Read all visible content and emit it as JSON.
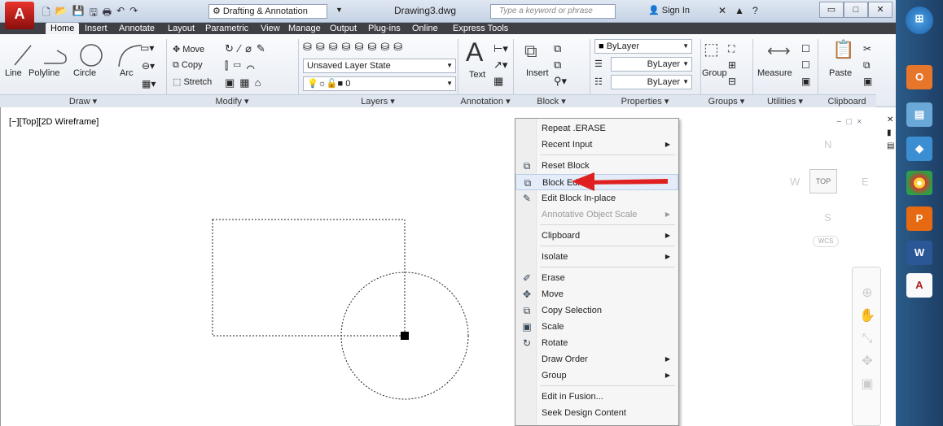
{
  "app": {
    "logo_letter": "A",
    "workspace": "Drafting & Annotation",
    "doc_title": "Drawing3.dwg",
    "search_placeholder": "Type a keyword or phrase",
    "signin": "Sign In"
  },
  "tabs": [
    "Home",
    "Insert",
    "Annotate",
    "Layout",
    "Parametric",
    "View",
    "Manage",
    "Output",
    "Plug-ins",
    "Online",
    "Express Tools"
  ],
  "ribbon": {
    "draw": {
      "title": "Draw",
      "items": [
        "Line",
        "Polyline",
        "Circle",
        "Arc"
      ]
    },
    "modify": {
      "title": "Modify",
      "move": "Move",
      "copy": "Copy",
      "stretch": "Stretch"
    },
    "layers": {
      "title": "Layers",
      "state": "Unsaved Layer State",
      "layer": "0"
    },
    "annotation": {
      "title": "Annotation",
      "text": "Text"
    },
    "block": {
      "title": "Block",
      "insert": "Insert"
    },
    "properties": {
      "title": "Properties",
      "color": "ByLayer",
      "linetype": "ByLayer",
      "lineweight": "ByLayer"
    },
    "groups": {
      "title": "Groups",
      "group": "Group"
    },
    "utilities": {
      "title": "Utilities",
      "measure": "Measure"
    },
    "clipboard": {
      "title": "Clipboard",
      "paste": "Paste"
    }
  },
  "viewport": {
    "label": "[−][Top][2D Wireframe]",
    "ctrl_min": "−",
    "ctrl_max": "□",
    "ctrl_close": "×"
  },
  "viewcube": {
    "n": "N",
    "s": "S",
    "e": "E",
    "w": "W",
    "top": "TOP",
    "wcs": "WCS"
  },
  "context_menu": [
    {
      "label": "Repeat .ERASE",
      "type": "item"
    },
    {
      "label": "Recent Input",
      "type": "sub"
    },
    {
      "type": "sep"
    },
    {
      "label": "Reset Block",
      "type": "item",
      "icon": "reset-block"
    },
    {
      "label": "Block Editor",
      "type": "item",
      "icon": "block-editor",
      "highlight": true
    },
    {
      "label": "Edit Block In-place",
      "type": "item",
      "icon": "edit-in-place"
    },
    {
      "label": "Annotative Object Scale",
      "type": "sub",
      "disabled": true
    },
    {
      "type": "sep"
    },
    {
      "label": "Clipboard",
      "type": "sub"
    },
    {
      "type": "sep"
    },
    {
      "label": "Isolate",
      "type": "sub"
    },
    {
      "type": "sep"
    },
    {
      "label": "Erase",
      "type": "item",
      "icon": "erase"
    },
    {
      "label": "Move",
      "type": "item",
      "icon": "move"
    },
    {
      "label": "Copy Selection",
      "type": "item",
      "icon": "copy"
    },
    {
      "label": "Scale",
      "type": "item",
      "icon": "scale"
    },
    {
      "label": "Rotate",
      "type": "item",
      "icon": "rotate"
    },
    {
      "label": "Draw Order",
      "type": "sub"
    },
    {
      "label": "Group",
      "type": "sub"
    },
    {
      "type": "sep"
    },
    {
      "label": "Edit in Fusion...",
      "type": "item"
    },
    {
      "label": "Seek Design Content",
      "type": "item"
    }
  ],
  "colors": {
    "accent_red": "#e02020",
    "selection_grip": "#1e6fd9"
  }
}
